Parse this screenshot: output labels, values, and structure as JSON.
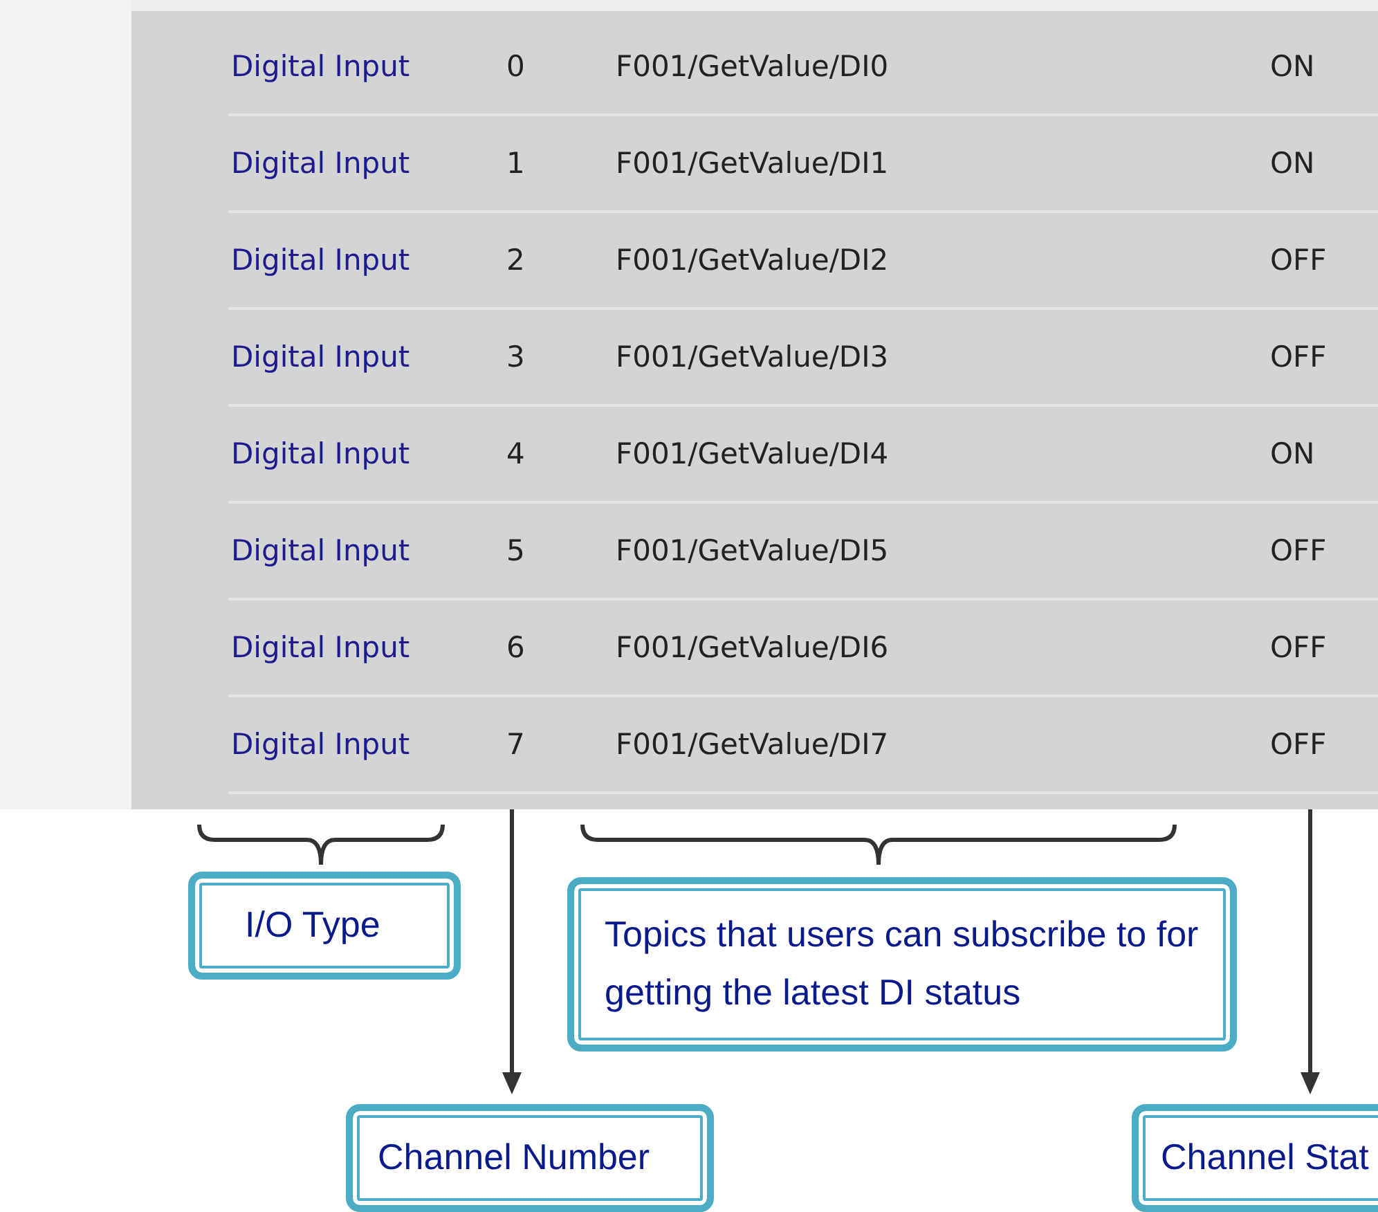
{
  "table": {
    "rows": [
      {
        "io_type": "Digital Input",
        "channel": "0",
        "topic": "F001/GetValue/DI0",
        "status": "ON"
      },
      {
        "io_type": "Digital Input",
        "channel": "1",
        "topic": "F001/GetValue/DI1",
        "status": "ON"
      },
      {
        "io_type": "Digital Input",
        "channel": "2",
        "topic": "F001/GetValue/DI2",
        "status": "OFF"
      },
      {
        "io_type": "Digital Input",
        "channel": "3",
        "topic": "F001/GetValue/DI3",
        "status": "OFF"
      },
      {
        "io_type": "Digital Input",
        "channel": "4",
        "topic": "F001/GetValue/DI4",
        "status": "ON"
      },
      {
        "io_type": "Digital Input",
        "channel": "5",
        "topic": "F001/GetValue/DI5",
        "status": "OFF"
      },
      {
        "io_type": "Digital Input",
        "channel": "6",
        "topic": "F001/GetValue/DI6",
        "status": "OFF"
      },
      {
        "io_type": "Digital Input",
        "channel": "7",
        "topic": "F001/GetValue/DI7",
        "status": "OFF"
      }
    ]
  },
  "annotations": [
    {
      "kind": "brace",
      "label": "I/O Type"
    },
    {
      "kind": "arrow",
      "label": "Channel Number"
    },
    {
      "kind": "brace",
      "label": "Topics that users can subscribe to for getting the latest DI status"
    },
    {
      "kind": "arrow",
      "label": "Channel Stat"
    }
  ]
}
